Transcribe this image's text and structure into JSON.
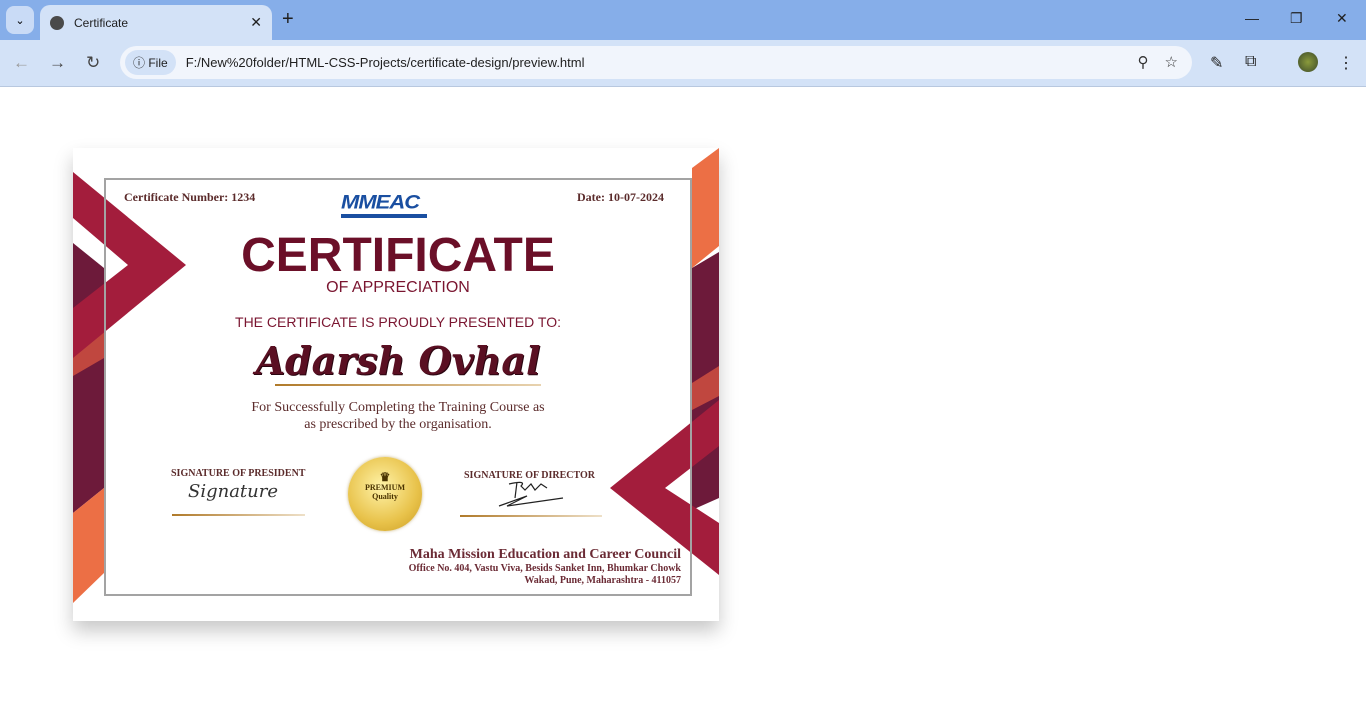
{
  "browser": {
    "tab_title": "Certificate",
    "url_chip": "File",
    "url": "F:/New%20folder/HTML-CSS-Projects/certificate-design/preview.html"
  },
  "certificate": {
    "number": "Certificate Number: 1234",
    "date": "Date: 10-07-2024",
    "logo_text": "MMEAC",
    "title": "CERTIFICATE",
    "subtitle": "OF APPRECIATION",
    "presented": "THE CERTIFICATE IS PROUDLY PRESENTED TO:",
    "recipient": "Adarsh Ovhal",
    "description_line1": "For Successfully Completing the Training Course as",
    "description_line2": "as prescribed by the organisation.",
    "sig_president_label": "SIGNATURE OF PRESIDENT",
    "sig_president": "Signature",
    "sig_director_label": "SIGNATURE OF DIRECTOR",
    "seal_line1": "PREMIUM",
    "seal_line2": "Quality",
    "org_name": "Maha Mission Education and Career Council",
    "org_address1": "Office No. 404, Vastu Viva, Besids Sanket Inn, Bhumkar Chowk",
    "org_address2": "Wakad, Pune, Maharashtra - 411057"
  },
  "colors": {
    "crimson": "#a31d3c",
    "plum": "#6d1a3a",
    "orange": "#ec6f45",
    "title": "#6b0f28"
  }
}
